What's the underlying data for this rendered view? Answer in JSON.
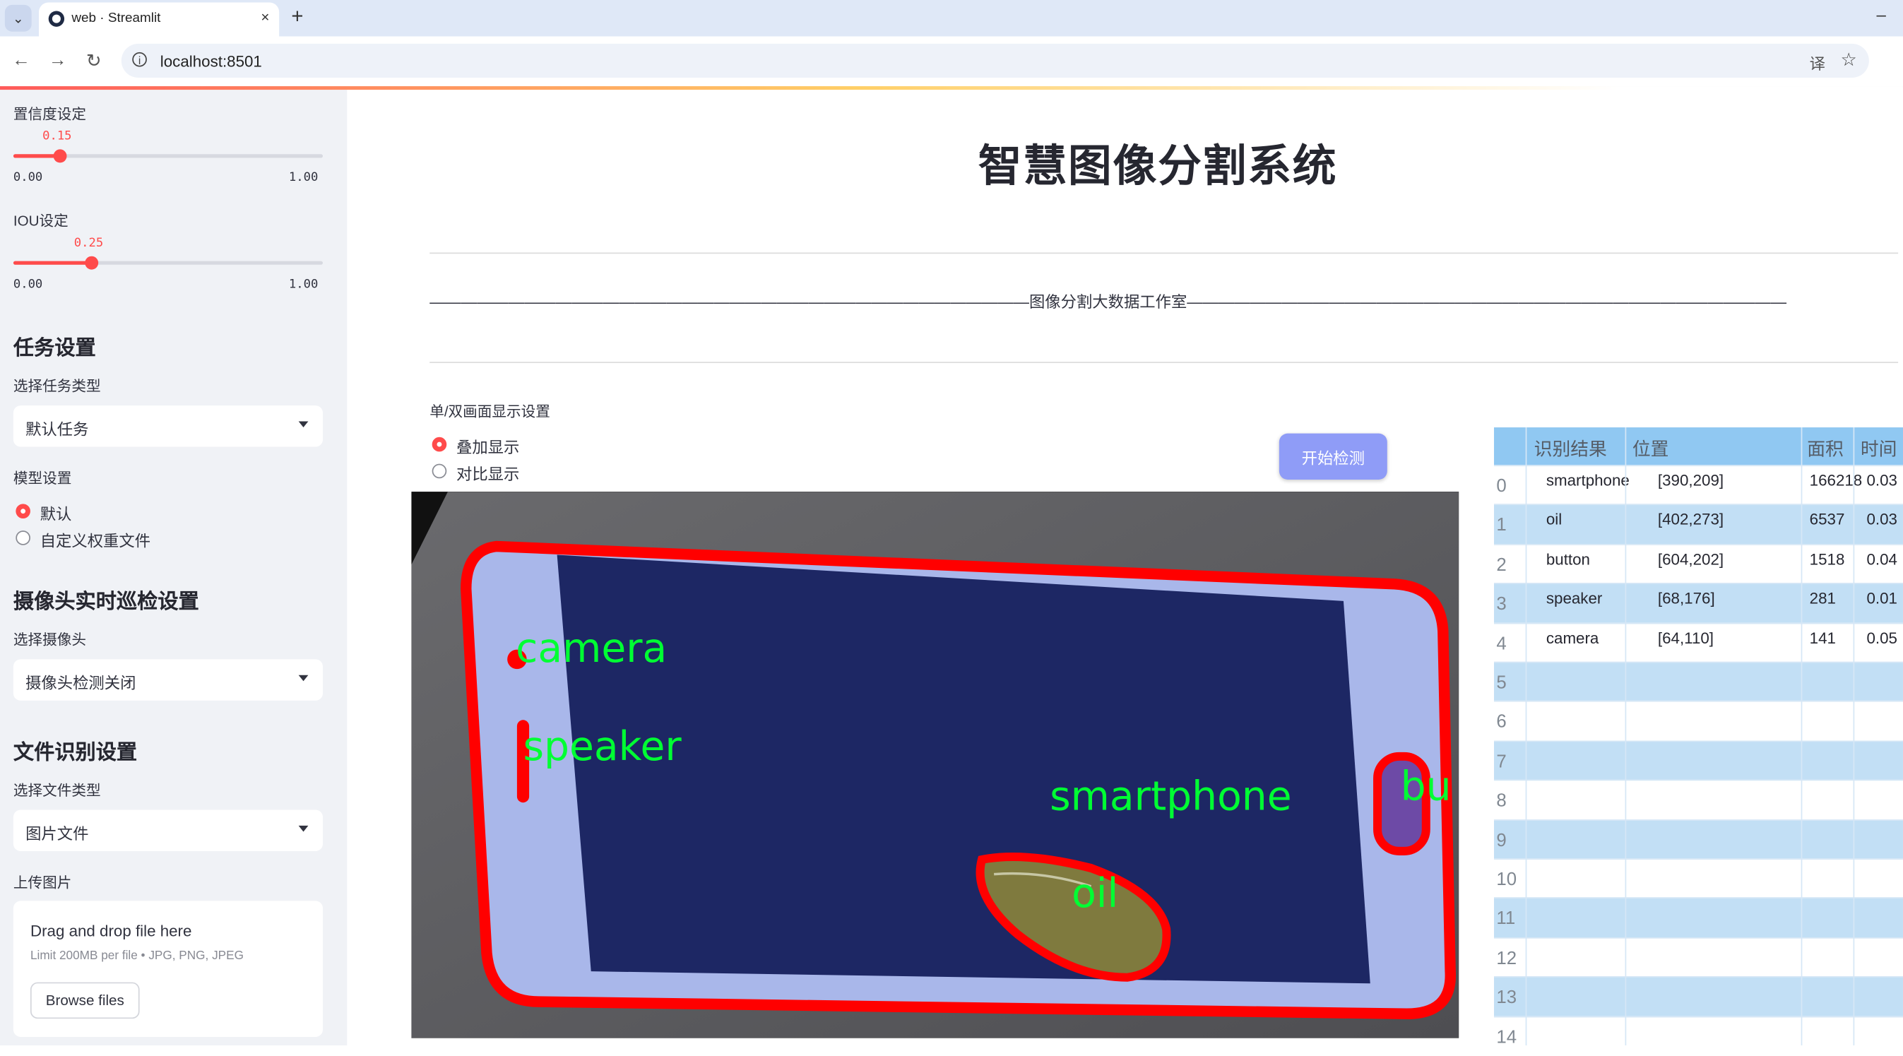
{
  "browser": {
    "tab_title": "web · Streamlit",
    "tab_close": "×",
    "new_tab": "+",
    "minimize": "–",
    "url": "localhost:8501",
    "back": "←",
    "forward": "→",
    "reload": "↻",
    "info": "i",
    "translate": "译",
    "bookmark": "☆",
    "tab_dropdown": "⌄"
  },
  "sidebar": {
    "confidence_label": "置信度设定",
    "confidence_value": "0.15",
    "confidence_min": "0.00",
    "confidence_max": "1.00",
    "confidence_fraction": 0.15,
    "iou_label": "IOU设定",
    "iou_value": "0.25",
    "iou_min": "0.00",
    "iou_max": "1.00",
    "iou_fraction": 0.25,
    "task_heading": "任务设置",
    "task_type_label": "选择任务类型",
    "task_type_value": "默认任务",
    "model_label": "模型设置",
    "model_options": [
      "默认",
      "自定义权重文件"
    ],
    "model_selected": "默认",
    "camera_heading": "摄像头实时巡检设置",
    "camera_label": "选择摄像头",
    "camera_value": "摄像头检测关闭",
    "file_heading": "文件识别设置",
    "file_type_label": "选择文件类型",
    "file_type_value": "图片文件",
    "upload_label": "上传图片",
    "upload_title": "Drag and drop file here",
    "upload_limit": "Limit 200MB per file • JPG, PNG, JPEG",
    "browse_button": "Browse files"
  },
  "main": {
    "title": "智慧图像分割系统",
    "subtitle": "——————————————————————————————————————图像分割大数据工作室——————————————————————————————————————",
    "display_label": "单/双画面显示设置",
    "display_options": [
      "叠加显示",
      "对比显示"
    ],
    "display_selected": "叠加显示",
    "start_button": "开始检测",
    "detections": {
      "camera": "camera",
      "speaker": "speaker",
      "smartphone": "smartphone",
      "oil": "oil",
      "button": "bu"
    }
  },
  "table": {
    "headers": [
      "识别结果",
      "位置",
      "面积",
      "时间"
    ],
    "rows": [
      {
        "index": "0",
        "result": "smartphone",
        "position": "[390,209]",
        "area": "166218",
        "time": "0.03"
      },
      {
        "index": "1",
        "result": "oil",
        "position": "[402,273]",
        "area": "6537",
        "time": "0.03"
      },
      {
        "index": "2",
        "result": "button",
        "position": "[604,202]",
        "area": "1518",
        "time": "0.04"
      },
      {
        "index": "3",
        "result": "speaker",
        "position": "[68,176]",
        "area": "281",
        "time": "0.01"
      },
      {
        "index": "4",
        "result": "camera",
        "position": "[64,110]",
        "area": "141",
        "time": "0.05"
      },
      {
        "index": "5",
        "result": "",
        "position": "",
        "area": "",
        "time": ""
      },
      {
        "index": "6",
        "result": "",
        "position": "",
        "area": "",
        "time": ""
      },
      {
        "index": "7",
        "result": "",
        "position": "",
        "area": "",
        "time": ""
      },
      {
        "index": "8",
        "result": "",
        "position": "",
        "area": "",
        "time": ""
      },
      {
        "index": "9",
        "result": "",
        "position": "",
        "area": "",
        "time": ""
      },
      {
        "index": "10",
        "result": "",
        "position": "",
        "area": "",
        "time": ""
      },
      {
        "index": "11",
        "result": "",
        "position": "",
        "area": "",
        "time": ""
      },
      {
        "index": "12",
        "result": "",
        "position": "",
        "area": "",
        "time": ""
      },
      {
        "index": "13",
        "result": "",
        "position": "",
        "area": "",
        "time": ""
      },
      {
        "index": "14",
        "result": "",
        "position": "",
        "area": "",
        "time": ""
      }
    ]
  },
  "colors": {
    "accent": "#ff4b4b",
    "sidebar_bg": "#f0f2f6",
    "button_bg": "#8f9cf7",
    "table_header": "#90c8f2",
    "table_stripe": "#c2dff5",
    "mask_outline": "#ff0000",
    "label_green": "#00ff33"
  }
}
